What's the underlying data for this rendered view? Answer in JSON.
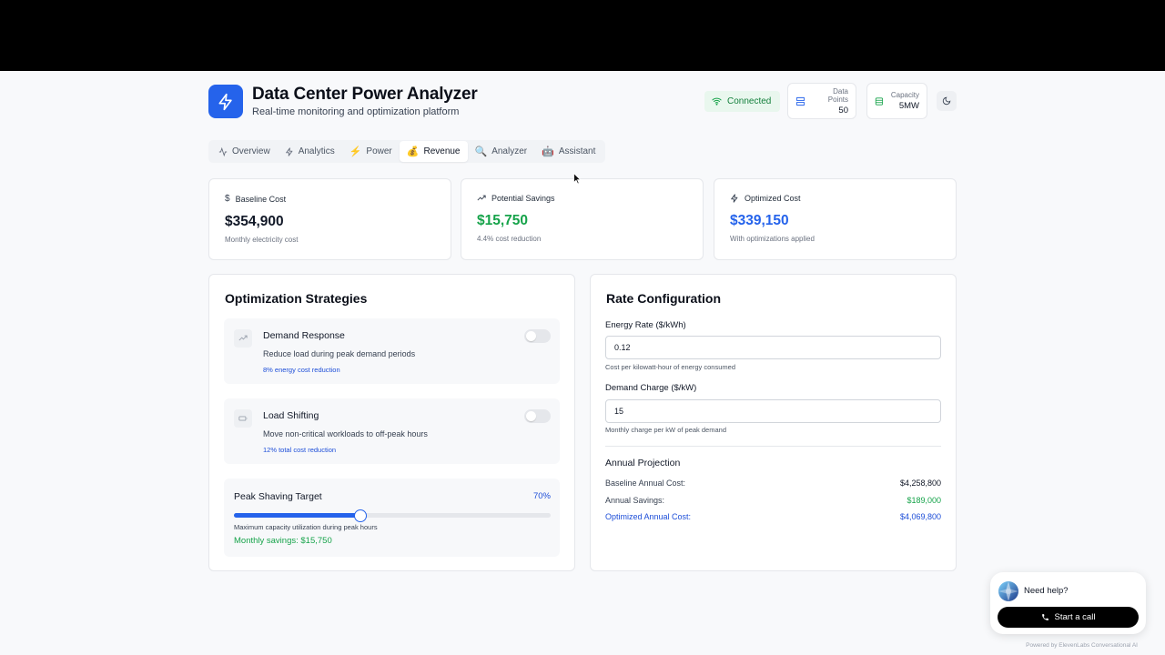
{
  "header": {
    "title": "Data Center Power Analyzer",
    "subtitle": "Real-time monitoring and optimization platform",
    "status": "Connected",
    "data_points_label": "Data Points",
    "data_points_value": "50",
    "capacity_label": "Capacity",
    "capacity_value": "5MW"
  },
  "tabs": [
    {
      "label": "Overview",
      "icon": "activity-icon"
    },
    {
      "label": "Analytics",
      "icon": "zap-icon"
    },
    {
      "label": "Power",
      "icon": "lightning-emoji-icon"
    },
    {
      "label": "Revenue",
      "icon": "money-bag-emoji-icon",
      "active": true
    },
    {
      "label": "Analyzer",
      "icon": "magnifier-emoji-icon"
    },
    {
      "label": "Assistant",
      "icon": "robot-emoji-icon"
    }
  ],
  "metrics": [
    {
      "label": "Baseline Cost",
      "value": "$354,900",
      "note": "Monthly electricity cost",
      "color": "#111827",
      "icon": "dollar-icon"
    },
    {
      "label": "Potential Savings",
      "value": "$15,750",
      "note": "4.4% cost reduction",
      "color": "#16a34a",
      "icon": "trending-up-icon"
    },
    {
      "label": "Optimized Cost",
      "value": "$339,150",
      "note": "With optimizations applied",
      "color": "#2563eb",
      "icon": "zap-icon"
    }
  ],
  "strategies": {
    "title": "Optimization Strategies",
    "items": [
      {
        "name": "Demand Response",
        "desc": "Reduce load during peak demand periods",
        "impact": "8% energy cost reduction",
        "enabled": false,
        "icon": "trending-up-icon"
      },
      {
        "name": "Load Shifting",
        "desc": "Move non-critical workloads to off-peak hours",
        "impact": "12% total cost reduction",
        "enabled": false,
        "icon": "battery-icon"
      }
    ],
    "peak": {
      "label": "Peak Shaving Target",
      "value_text": "70%",
      "value": 0.4,
      "note": "Maximum capacity utilization during peak hours",
      "savings": "Monthly savings: $15,750"
    }
  },
  "rates": {
    "title": "Rate Configuration",
    "energy_label": "Energy Rate ($/kWh)",
    "energy_value": "0.12",
    "energy_help": "Cost per kilowatt-hour of energy consumed",
    "demand_label": "Demand Charge ($/kW)",
    "demand_value": "15",
    "demand_help": "Monthly charge per kW of peak demand",
    "projection_title": "Annual Projection",
    "projection": [
      {
        "label": "Baseline Annual Cost:",
        "value": "$4,258,800"
      },
      {
        "label": "Annual Savings:",
        "value": "$189,000"
      },
      {
        "label": "Optimized Annual Cost:",
        "value": "$4,069,800"
      }
    ]
  },
  "widget": {
    "help": "Need help?",
    "call": "Start a call",
    "powered": "Powered by ElevenLabs Conversational AI"
  },
  "colors": {
    "accent": "#2563eb",
    "success": "#16a34a",
    "link": "#1d4ed8"
  }
}
